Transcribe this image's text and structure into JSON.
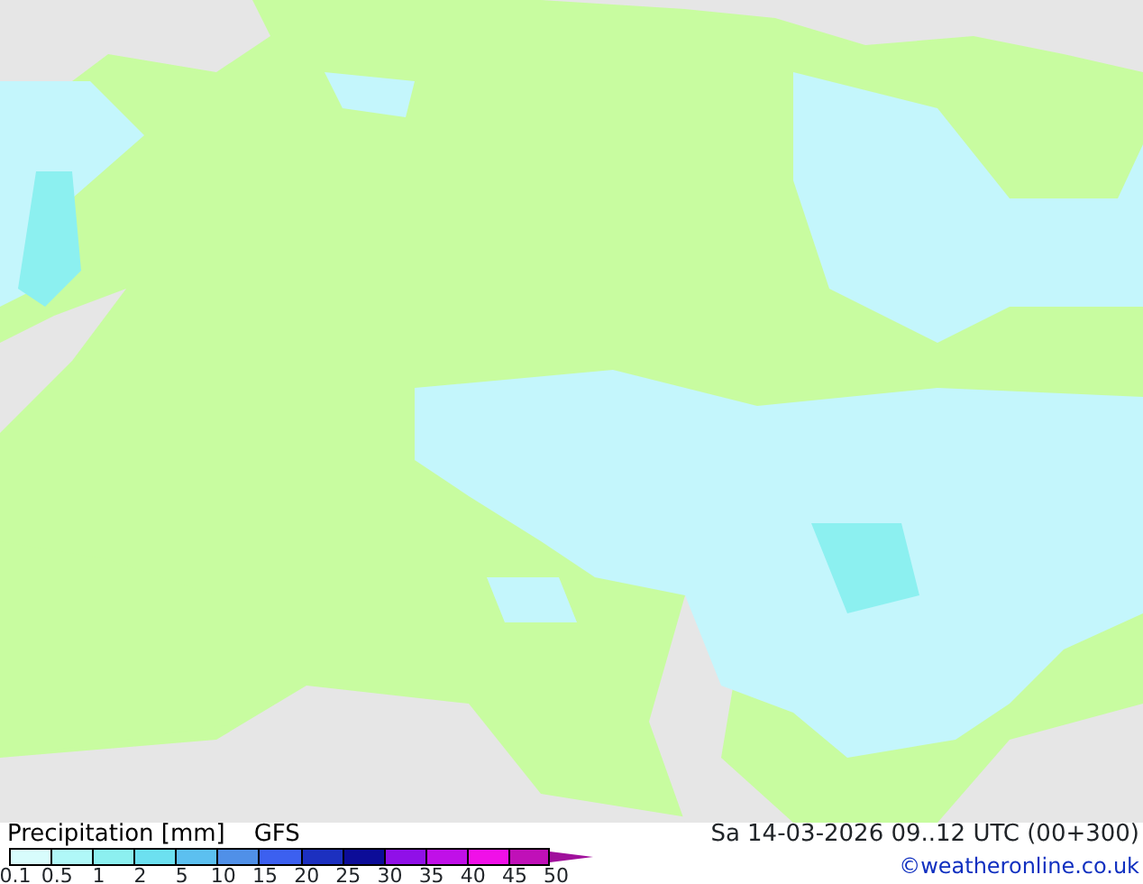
{
  "map": {
    "kind": "precipitation"
  },
  "legend": {
    "title": "Precipitation [mm]",
    "model": "GFS",
    "bins": [
      {
        "color": "#d8fcfc"
      },
      {
        "color": "#b0f8f8"
      },
      {
        "color": "#8cf0f0"
      },
      {
        "color": "#6ce0f0"
      },
      {
        "color": "#5cc0f0"
      },
      {
        "color": "#5090e8"
      },
      {
        "color": "#3c60f0"
      },
      {
        "color": "#1c30c0"
      },
      {
        "color": "#0c0c98"
      },
      {
        "color": "#9010e8"
      },
      {
        "color": "#c010e8"
      },
      {
        "color": "#f010e8"
      },
      {
        "color": "#c010b8"
      }
    ],
    "ticks": [
      "0.1",
      "0.5",
      "1",
      "2",
      "5",
      "10",
      "15",
      "20",
      "25",
      "30",
      "35",
      "40",
      "45",
      "50"
    ]
  },
  "valid_time": "Sa 14-03-2026 09..12 UTC (00+300)",
  "credit": "©weatheronline.co.uk"
}
